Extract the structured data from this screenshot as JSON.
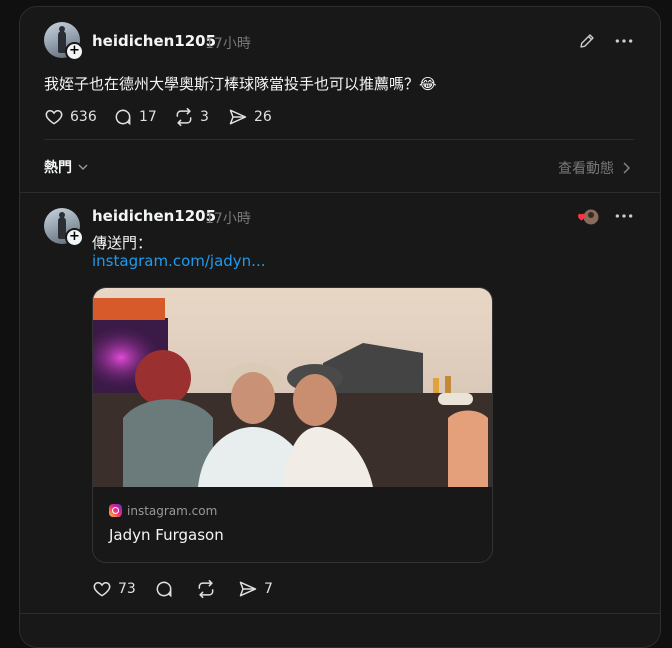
{
  "post1": {
    "username": "heidichen1205",
    "time": "17小時",
    "text": "我姪子也在德州大學奧斯汀棒球隊當投手也可以推薦嗎？😂",
    "likes": "636",
    "comments": "17",
    "reposts": "3",
    "shares": "26"
  },
  "sort": {
    "label": "熱門",
    "view_activity": "查看動態"
  },
  "reply": {
    "username": "heidichen1205",
    "time": "17小時",
    "text": "傳送門：",
    "link": "instagram.com/jadyn...",
    "card": {
      "domain": "instagram.com",
      "title": "Jadyn Furgason"
    },
    "likes": "73",
    "shares": "7"
  },
  "icons": {
    "like": "heart-icon",
    "comment": "comment-icon",
    "repost": "repost-icon",
    "share": "share-icon",
    "edit": "pencil-icon",
    "more": "more-icon"
  }
}
